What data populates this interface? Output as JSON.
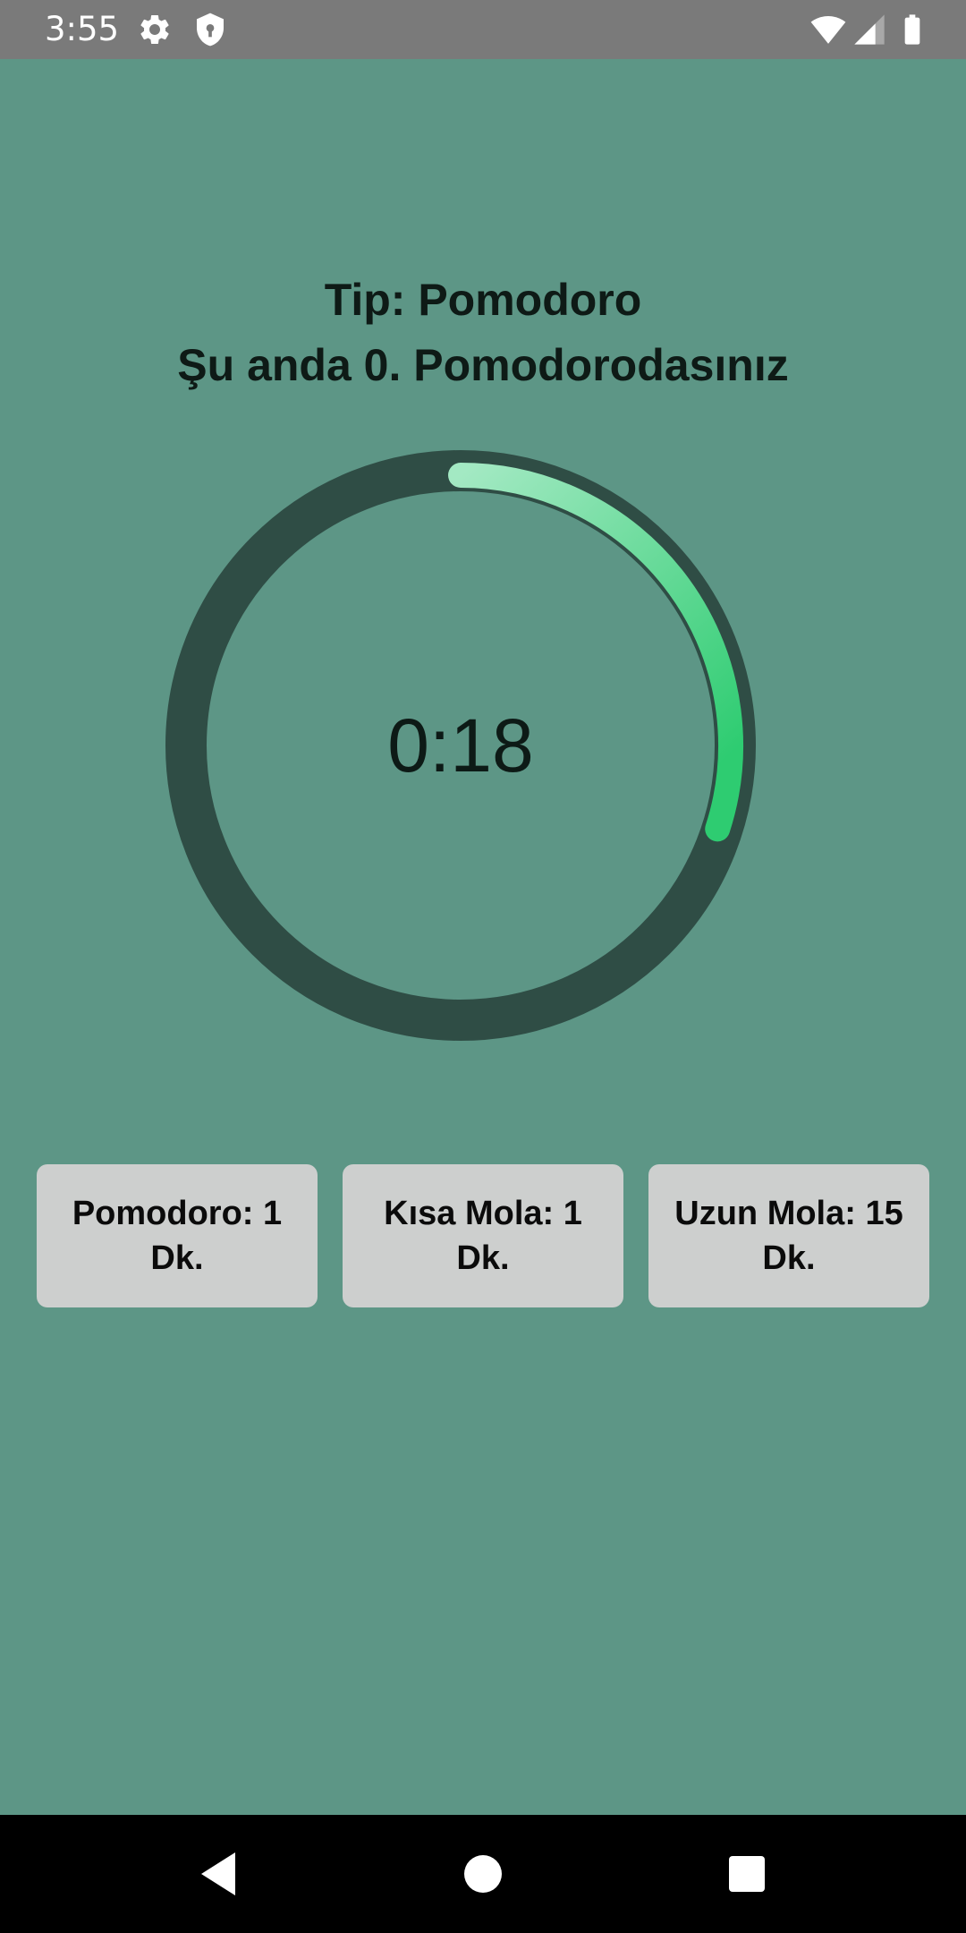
{
  "status_bar": {
    "time": "3:55",
    "left_icons": [
      "gear-icon",
      "shield-icon"
    ],
    "right_icons": [
      "wifi-icon",
      "signal-icon",
      "battery-icon"
    ]
  },
  "header": {
    "type_label": "Tip: Pomodoro",
    "session_label": "Şu anda 0. Pomodorodasınız"
  },
  "timer": {
    "time_remaining": "0:18",
    "progress_fraction": 0.3,
    "colors": {
      "track": "#2f4d45",
      "progress_start": "#a3e9c3",
      "progress_end": "#2ecc71",
      "background": "#5d9686"
    }
  },
  "modes": [
    {
      "label": "Pomodoro: 1 Dk."
    },
    {
      "label": "Kısa Mola: 1 Dk."
    },
    {
      "label": "Uzun Mola: 15 Dk."
    }
  ],
  "nav_bar": {
    "icons": [
      "back-icon",
      "home-icon",
      "recents-icon"
    ]
  }
}
